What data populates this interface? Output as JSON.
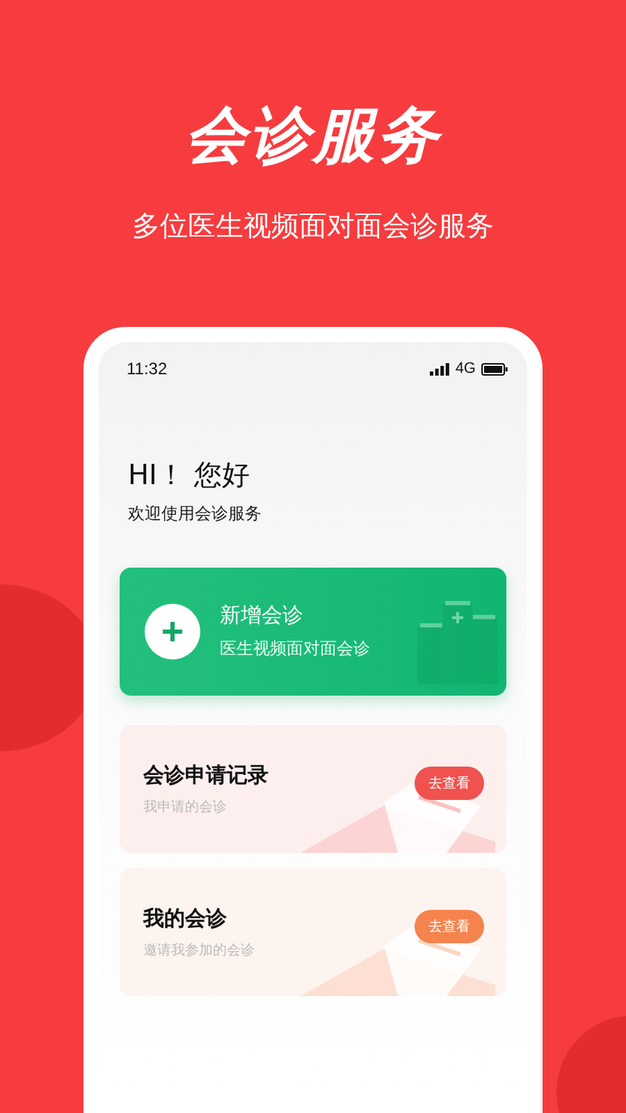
{
  "header": {
    "title": "会诊服务",
    "subtitle": "多位医生视频面对面会诊服务"
  },
  "status_bar": {
    "time": "11:32",
    "network": "4G"
  },
  "greeting": {
    "title": "HI！ 您好",
    "subtitle": "欢迎使用会诊服务"
  },
  "new_consultation": {
    "title": "新增会诊",
    "subtitle": "医生视频面对面会诊"
  },
  "cards": [
    {
      "title": "会诊申请记录",
      "subtitle": "我申请的会诊",
      "button": "去查看",
      "color": "#f0524f"
    },
    {
      "title": "我的会诊",
      "subtitle": "邀请我参加的会诊",
      "button": "去查看",
      "color": "#f5834e"
    }
  ]
}
